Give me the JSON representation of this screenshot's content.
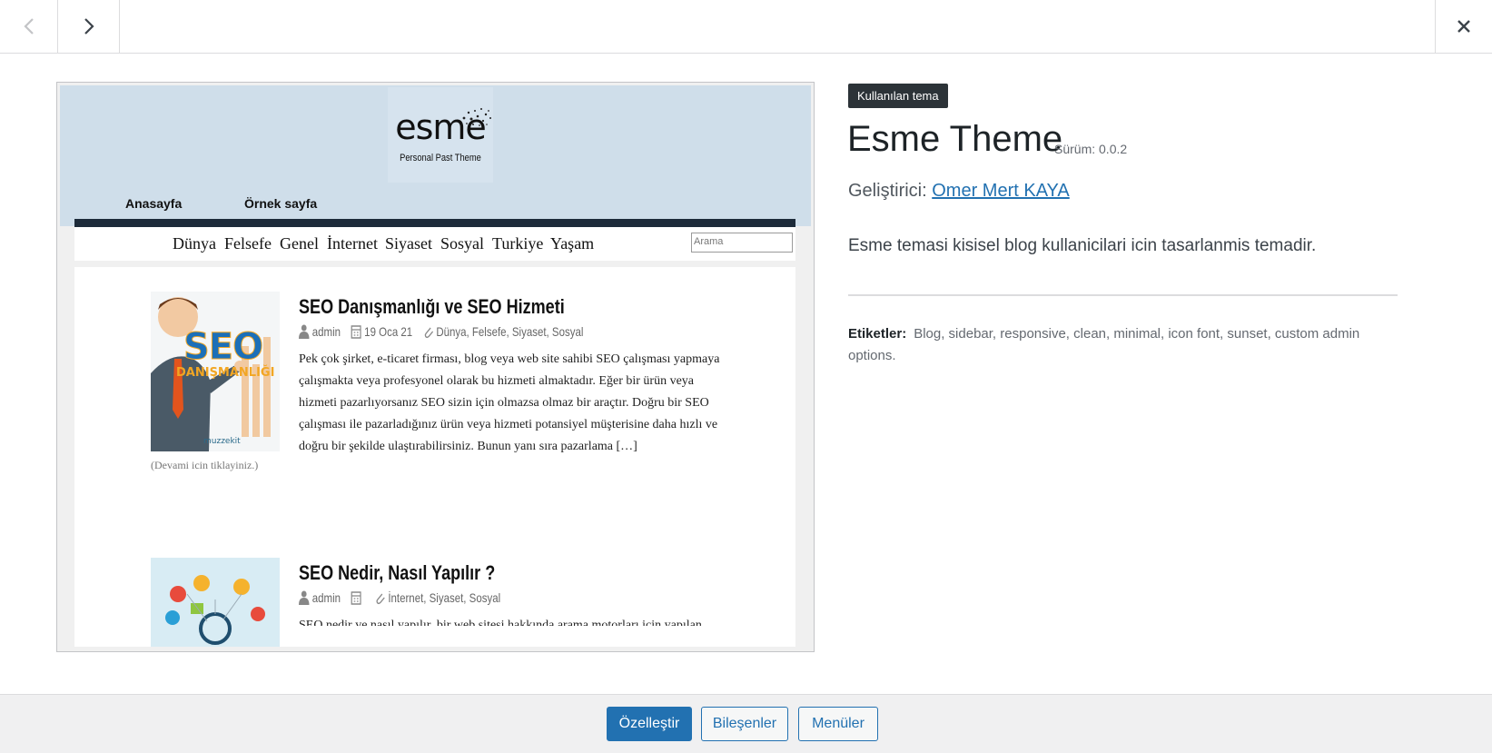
{
  "nav": {
    "prev_icon": "chevron-left-icon",
    "next_icon": "chevron-right-icon",
    "close_icon": "close-icon"
  },
  "screenshot": {
    "logo_word": "esme",
    "logo_sub": "Personal Past Theme",
    "top_menu": [
      "Anasayfa",
      "Örnek sayfa"
    ],
    "categories": [
      "Dünya",
      "Felsefe",
      "Genel",
      "İnternet",
      "Siyaset",
      "Sosyal",
      "Turkiye",
      "Yaşam"
    ],
    "search_placeholder": "Arama",
    "posts": [
      {
        "title": "SEO Danışmanlığı ve SEO Hizmeti",
        "author": "admin",
        "date": "19 Oca 21",
        "cats": "Dünya, Felsefe, Siyaset, Sosyal",
        "excerpt": "Pek çok şirket, e-ticaret firması, blog veya web site sahibi SEO çalışması yapmaya çalışmakta veya profesyonel olarak bu hizmeti almaktadır. Eğer bir ürün veya hizmeti pazarlıyorsanız SEO sizin için olmazsa olmaz bir araçtır. Doğru bir SEO çalışması ile pazarladığınız ürün veya hizmeti potansiyel müşterisine daha hızlı ve doğru bir şekilde ulaştırabilirsiniz. Bunun yanı sıra pazarlama […]",
        "more": "(Devami icin tiklayiniz.)",
        "thumb_text_1": "SEO",
        "thumb_text_2": "DANIŞMANLIĞI",
        "thumb_brand": "muzzekit"
      },
      {
        "title": "SEO Nedir, Nasıl Yapılır ?",
        "author": "admin",
        "date": "",
        "cats": "İnternet, Siyaset, Sosyal",
        "excerpt": "SEO nedir ve nasıl yapılır, bir web sitesi hakkında arama motorları için yapılan"
      }
    ]
  },
  "info": {
    "badge": "Kullanılan tema",
    "name": "Esme Theme",
    "version": "Sürüm: 0.0.2",
    "author_label": "Geliştirici:",
    "author_name": "Omer Mert KAYA",
    "description": "Esme temasi kisisel blog kullanicilari icin tasarlanmis temadir.",
    "tags_label": "Etiketler:",
    "tags": "Blog, sidebar, responsive, clean, minimal, icon font, sunset, custom admin options."
  },
  "footer": {
    "customize": "Özelleştir",
    "widgets": "Bileşenler",
    "menus": "Menüler"
  },
  "colors": {
    "accent": "#2271b1",
    "badge_bg": "#2c3338",
    "footer_bg": "#f0f0f1"
  }
}
